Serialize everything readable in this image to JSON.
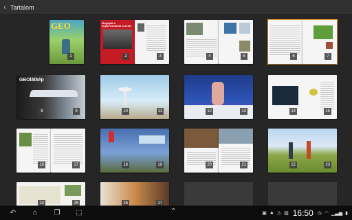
{
  "app_bar": {
    "title": "Tartalom",
    "back_icon": "chevron-left-icon"
  },
  "magazine": "GEO",
  "thumbs": [
    {
      "label": "1",
      "kind": "cover",
      "selected": false
    },
    {
      "label": "2",
      "kind": "cover-ad",
      "ad_text": "Megújult a legkeresettebb szerzői",
      "selected": false
    },
    {
      "label": "3",
      "kind": "page",
      "selected": false
    },
    {
      "labels": [
        "4",
        "5"
      ],
      "kind": "spread",
      "selected": false
    },
    {
      "labels": [
        "6",
        "7"
      ],
      "kind": "spread",
      "selected": true
    },
    {
      "labels": [
        "8",
        "9"
      ],
      "kind": "spread-photo",
      "headline": "GEOlátkép",
      "selected": false
    },
    {
      "labels": [
        "10",
        "11"
      ],
      "kind": "spread-photo",
      "selected": false
    },
    {
      "labels": [
        "12",
        "13"
      ],
      "kind": "spread-photo",
      "selected": false
    },
    {
      "labels": [
        "14",
        "15"
      ],
      "kind": "spread",
      "selected": false
    },
    {
      "labels": [
        "16",
        "17"
      ],
      "kind": "spread",
      "selected": false
    },
    {
      "labels": [
        "18",
        "19"
      ],
      "kind": "spread-photo",
      "selected": false
    },
    {
      "labels": [
        "20",
        "21"
      ],
      "kind": "spread",
      "selected": false
    },
    {
      "labels": [
        "22",
        "23"
      ],
      "kind": "spread-photo",
      "selected": false
    },
    {
      "labels": [
        "24",
        "25"
      ],
      "kind": "spread",
      "selected": false
    },
    {
      "labels": [
        "26",
        "27"
      ],
      "kind": "spread-photo",
      "selected": false
    },
    {
      "labels": [],
      "kind": "loading",
      "selected": false
    },
    {
      "labels": [],
      "kind": "loading",
      "selected": false
    }
  ],
  "navbar": {
    "back_icon": "back-arrow-icon",
    "home_icon": "home-icon",
    "recent_icon": "recent-apps-icon",
    "screenshot_icon": "screenshot-icon",
    "expand_icon": "chevron-up-icon",
    "time": "16:50",
    "status_icons": [
      "gallery-icon",
      "upload-icon",
      "warning-icon",
      "image-icon",
      "clock-icon",
      "wifi-icon",
      "signal-icon",
      "battery-icon"
    ]
  },
  "colors": {
    "accent": "#f7b731",
    "bg": "#262626"
  }
}
